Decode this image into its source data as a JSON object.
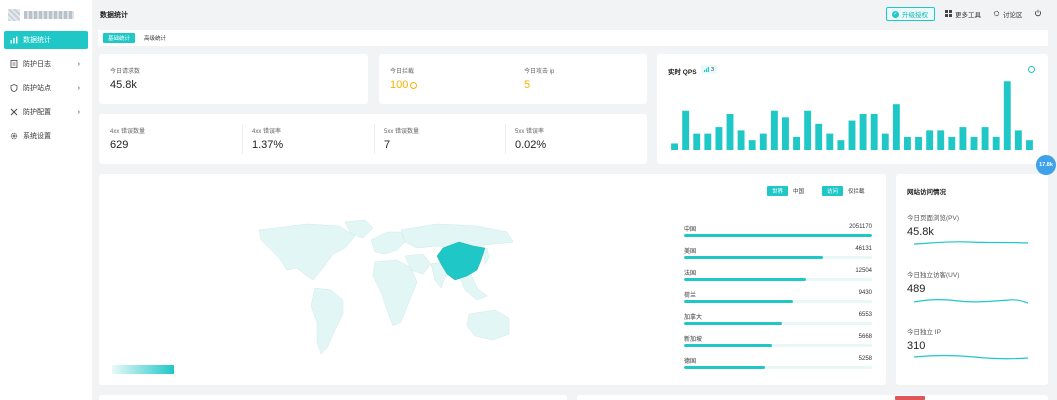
{
  "header": {
    "page_title": "数据统计",
    "upgrade_label": "升级授权",
    "more_tools_label": "更多工具",
    "forum_label": "讨论区"
  },
  "sidebar": {
    "items": [
      {
        "label": "数据统计",
        "icon": "bar-chart-icon",
        "active": true
      },
      {
        "label": "防护日志",
        "icon": "log-icon",
        "chevron": "›"
      },
      {
        "label": "防护站点",
        "icon": "shield-icon",
        "chevron": "›"
      },
      {
        "label": "防护配置",
        "icon": "tools-icon",
        "chevron": "›"
      },
      {
        "label": "系统设置",
        "icon": "gear-icon"
      }
    ]
  },
  "tabs": [
    {
      "label": "基础统计",
      "active": true
    },
    {
      "label": "高级统计",
      "active": false
    }
  ],
  "stats": {
    "requests_today_label": "今日请求数",
    "requests_today_value": "45.8k",
    "blocked_today_label": "今日拦截",
    "blocked_today_value": "100",
    "attack_ip_label": "今日攻击 ip",
    "attack_ip_value": "5",
    "err4xx_count_label": "4xx 错误数量",
    "err4xx_count_value": "629",
    "err4xx_rate_label": "4xx 错误率",
    "err4xx_rate_value": "1.37%",
    "err5xx_count_label": "5xx 错误数量",
    "err5xx_count_value": "7",
    "err5xx_rate_label": "5xx 错误率",
    "err5xx_rate_value": "0.02%"
  },
  "qps": {
    "title": "实时 QPS",
    "badge": "3",
    "chart_data": {
      "type": "bar",
      "values": [
        2,
        12,
        5,
        5,
        7,
        11,
        6,
        3,
        5,
        12,
        10,
        4,
        12,
        8,
        5,
        3,
        9,
        11,
        11,
        5,
        14,
        4,
        4,
        6,
        6,
        4,
        7,
        4,
        7,
        4,
        21,
        6,
        3
      ],
      "ylim": [
        0,
        22
      ],
      "color": "#20c7c7"
    }
  },
  "map": {
    "scope_options": [
      "世界",
      "中国"
    ],
    "scope_selected": "世界",
    "mode_options": [
      "访问",
      "仅拦截"
    ],
    "mode_selected": "访问",
    "highlight_color": "#20c7c7",
    "rankings": [
      {
        "name": "中国",
        "value": "2051170",
        "fraction": 1.0
      },
      {
        "name": "美国",
        "value": "46131",
        "fraction": 0.74
      },
      {
        "name": "法国",
        "value": "12504",
        "fraction": 0.65
      },
      {
        "name": "荷兰",
        "value": "9430",
        "fraction": 0.58
      },
      {
        "name": "加拿大",
        "value": "6553",
        "fraction": 0.52
      },
      {
        "name": "新加坡",
        "value": "5668",
        "fraction": 0.47
      },
      {
        "name": "德国",
        "value": "5258",
        "fraction": 0.43
      }
    ]
  },
  "site_visits": {
    "title": "网站访问情况",
    "pv_label": "今日页面浏览(PV)",
    "pv_value": "45.8k",
    "uv_label": "今日独立访客(UV)",
    "uv_value": "489",
    "ip_label": "今日独立 IP",
    "ip_value": "310"
  },
  "float_badge": "17.8k"
}
